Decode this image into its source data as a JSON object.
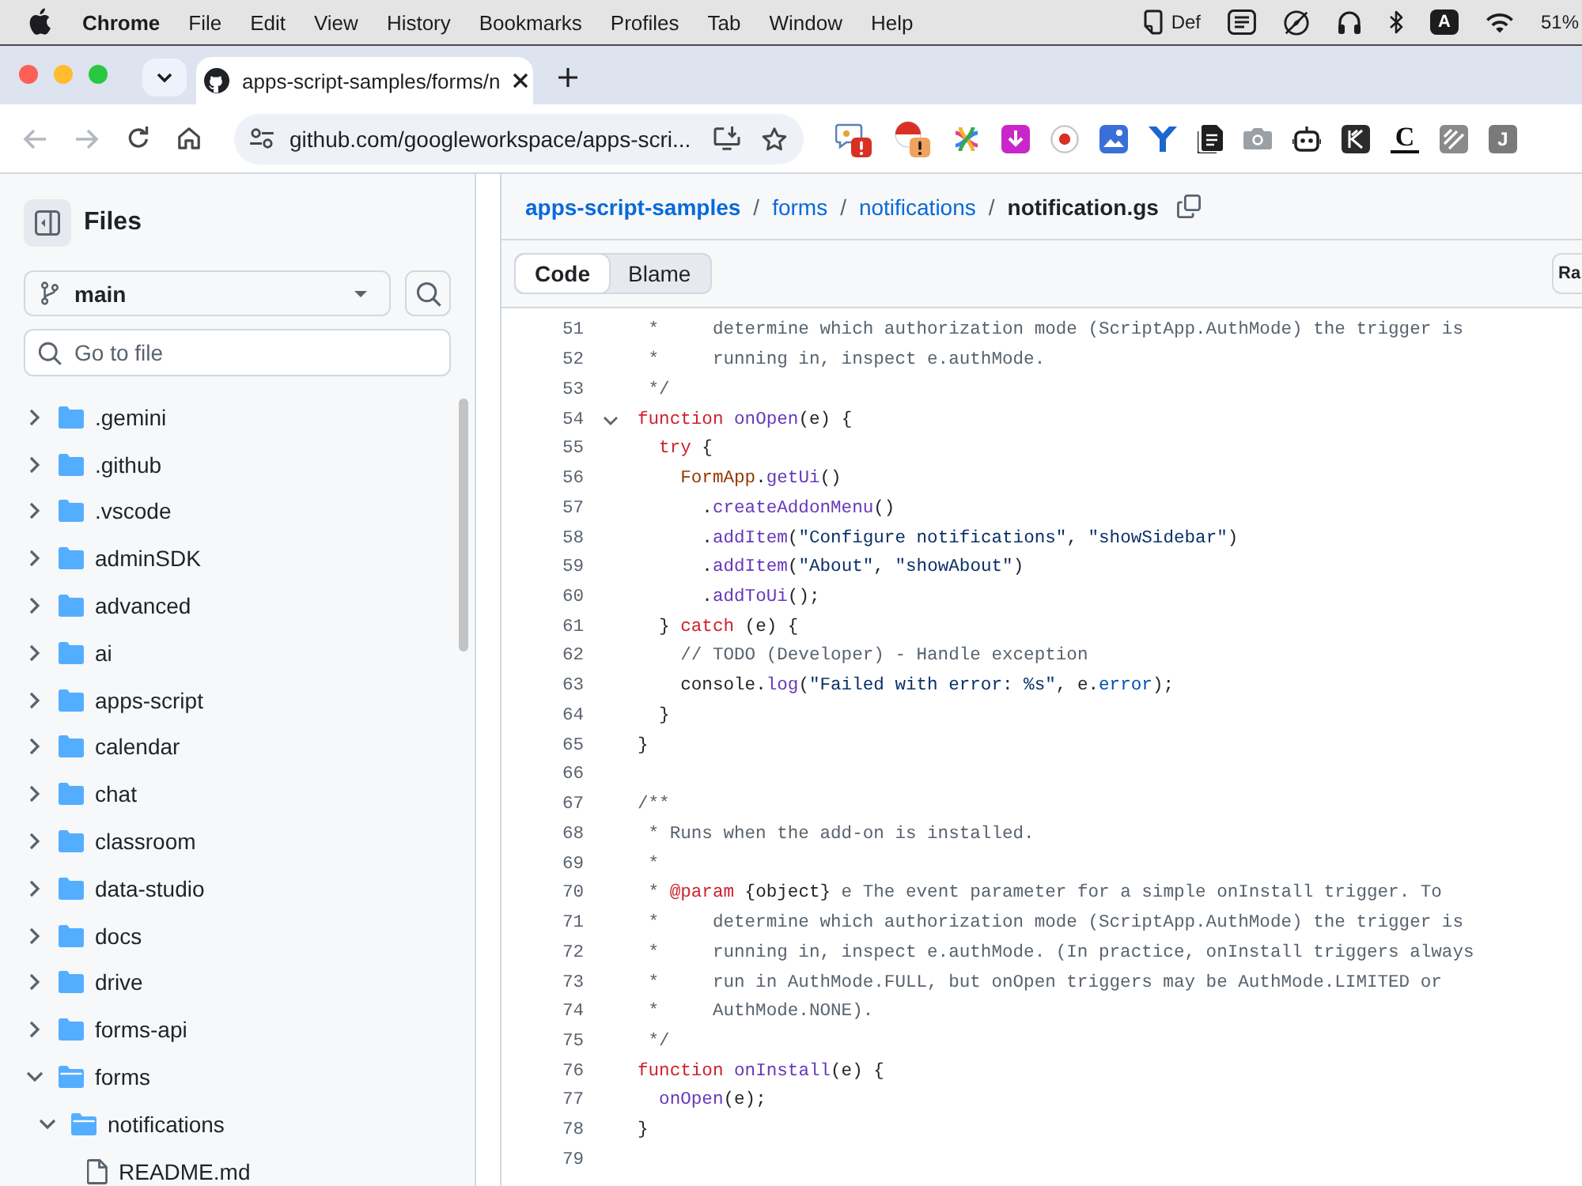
{
  "menu_bar": {
    "app_name": "Chrome",
    "menus": [
      "File",
      "Edit",
      "View",
      "History",
      "Bookmarks",
      "Profiles",
      "Tab",
      "Window",
      "Help"
    ],
    "status_label": "Def",
    "input_source": "A",
    "battery": "51%"
  },
  "browser": {
    "tabs": [
      {
        "title": "apps-script-samples/forms/n",
        "selected": true
      }
    ],
    "back": {
      "disabled": true
    },
    "forward": {
      "disabled": true
    },
    "url": "github.com/googleworkspace/apps-scri...",
    "extension_letters": [
      "C",
      "J"
    ]
  },
  "sidebar": {
    "title": "Files",
    "branch": "main",
    "file_search": {
      "placeholder": "Go to file"
    },
    "tree": [
      {
        "name": ".gemini",
        "kind": "folder",
        "expanded": false
      },
      {
        "name": ".github",
        "kind": "folder",
        "expanded": false
      },
      {
        "name": ".vscode",
        "kind": "folder",
        "expanded": false
      },
      {
        "name": "adminSDK",
        "kind": "folder",
        "expanded": false
      },
      {
        "name": "advanced",
        "kind": "folder",
        "expanded": false
      },
      {
        "name": "ai",
        "kind": "folder",
        "expanded": false
      },
      {
        "name": "apps-script",
        "kind": "folder",
        "expanded": false
      },
      {
        "name": "calendar",
        "kind": "folder",
        "expanded": false
      },
      {
        "name": "chat",
        "kind": "folder",
        "expanded": false
      },
      {
        "name": "classroom",
        "kind": "folder",
        "expanded": false
      },
      {
        "name": "data-studio",
        "kind": "folder",
        "expanded": false
      },
      {
        "name": "docs",
        "kind": "folder",
        "expanded": false
      },
      {
        "name": "drive",
        "kind": "folder",
        "expanded": false
      },
      {
        "name": "forms-api",
        "kind": "folder",
        "expanded": false
      },
      {
        "name": "forms",
        "kind": "folder",
        "expanded": true,
        "children": [
          {
            "name": "notifications",
            "kind": "folder",
            "expanded": true,
            "children": [
              {
                "name": "README.md",
                "kind": "file"
              }
            ]
          }
        ]
      }
    ]
  },
  "file_view": {
    "breadcrumb": [
      {
        "kind": "repo",
        "label": "apps-script-samples"
      },
      {
        "kind": "separator",
        "label": "/"
      },
      {
        "kind": "dir",
        "label": "forms"
      },
      {
        "kind": "separator",
        "label": "/"
      },
      {
        "kind": "dir",
        "label": "notifications"
      },
      {
        "kind": "separator",
        "label": "/"
      },
      {
        "kind": "file",
        "label": "notification.gs"
      }
    ],
    "view_tabs": [
      {
        "label": "Code",
        "selected": true
      },
      {
        "label": "Blame",
        "selected": false
      }
    ],
    "raw_button": "Ra",
    "lines": [
      {
        "number": "51",
        "fold": false,
        "tokens": [
          {
            "kind": "comment",
            "text": " *     determine which authorization mode (ScriptApp.AuthMode) the trigger is"
          }
        ]
      },
      {
        "number": "52",
        "fold": false,
        "tokens": [
          {
            "kind": "comment",
            "text": " *     running in, inspect e.authMode."
          }
        ]
      },
      {
        "number": "53",
        "fold": false,
        "tokens": [
          {
            "kind": "comment",
            "text": " */"
          }
        ]
      },
      {
        "number": "54",
        "fold": true,
        "tokens": [
          {
            "kind": "keyword",
            "text": "function"
          },
          {
            "kind": "function",
            "text": " onOpen"
          },
          {
            "kind": "plain",
            "text": "(e) {"
          }
        ]
      },
      {
        "number": "55",
        "fold": false,
        "tokens": [
          {
            "kind": "keyword",
            "text": "  try"
          },
          {
            "kind": "plain",
            "text": " {"
          }
        ]
      },
      {
        "number": "56",
        "fold": false,
        "tokens": [
          {
            "kind": "class",
            "text": "    FormApp"
          },
          {
            "kind": "plain",
            "text": "."
          },
          {
            "kind": "function",
            "text": "getUi"
          },
          {
            "kind": "plain",
            "text": "()"
          }
        ]
      },
      {
        "number": "57",
        "fold": false,
        "tokens": [
          {
            "kind": "plain",
            "text": "      ."
          },
          {
            "kind": "function",
            "text": "createAddonMenu"
          },
          {
            "kind": "plain",
            "text": "()"
          }
        ]
      },
      {
        "number": "58",
        "fold": false,
        "tokens": [
          {
            "kind": "plain",
            "text": "      ."
          },
          {
            "kind": "function",
            "text": "addItem"
          },
          {
            "kind": "plain",
            "text": "("
          },
          {
            "kind": "string",
            "text": "\"Configure notifications\""
          },
          {
            "kind": "plain",
            "text": ", "
          },
          {
            "kind": "string",
            "text": "\"showSidebar\""
          },
          {
            "kind": "plain",
            "text": ")"
          }
        ]
      },
      {
        "number": "59",
        "fold": false,
        "tokens": [
          {
            "kind": "plain",
            "text": "      ."
          },
          {
            "kind": "function",
            "text": "addItem"
          },
          {
            "kind": "plain",
            "text": "("
          },
          {
            "kind": "string",
            "text": "\"About\""
          },
          {
            "kind": "plain",
            "text": ", "
          },
          {
            "kind": "string",
            "text": "\"showAbout\""
          },
          {
            "kind": "plain",
            "text": ")"
          }
        ]
      },
      {
        "number": "60",
        "fold": false,
        "tokens": [
          {
            "kind": "plain",
            "text": "      ."
          },
          {
            "kind": "function",
            "text": "addToUi"
          },
          {
            "kind": "plain",
            "text": "();"
          }
        ]
      },
      {
        "number": "61",
        "fold": false,
        "tokens": [
          {
            "kind": "plain",
            "text": "  } "
          },
          {
            "kind": "keyword",
            "text": "catch"
          },
          {
            "kind": "plain",
            "text": " (e) {"
          }
        ]
      },
      {
        "number": "62",
        "fold": false,
        "tokens": [
          {
            "kind": "comment",
            "text": "    // TODO (Developer) - Handle exception"
          }
        ]
      },
      {
        "number": "63",
        "fold": false,
        "tokens": [
          {
            "kind": "plain",
            "text": "    console."
          },
          {
            "kind": "function",
            "text": "log"
          },
          {
            "kind": "plain",
            "text": "("
          },
          {
            "kind": "string",
            "text": "\"Failed with error: %s\""
          },
          {
            "kind": "plain",
            "text": ", e."
          },
          {
            "kind": "property",
            "text": "error"
          },
          {
            "kind": "plain",
            "text": ");"
          }
        ]
      },
      {
        "number": "64",
        "fold": false,
        "tokens": [
          {
            "kind": "plain",
            "text": "  }"
          }
        ]
      },
      {
        "number": "65",
        "fold": false,
        "tokens": [
          {
            "kind": "plain",
            "text": "}"
          }
        ]
      },
      {
        "number": "66",
        "fold": false
      },
      {
        "number": "67",
        "fold": false,
        "tokens": [
          {
            "kind": "comment",
            "text": "/**"
          }
        ]
      },
      {
        "number": "68",
        "fold": false,
        "tokens": [
          {
            "kind": "comment",
            "text": " * Runs when the add-on is installed."
          }
        ]
      },
      {
        "number": "69",
        "fold": false,
        "tokens": [
          {
            "kind": "comment",
            "text": " *"
          }
        ]
      },
      {
        "number": "70",
        "fold": false,
        "tokens": [
          {
            "kind": "comment",
            "text": " * "
          },
          {
            "kind": "tag",
            "text": "@param"
          },
          {
            "kind": "plain",
            "text": " {object}"
          },
          {
            "kind": "comment",
            "text": " e The event parameter for a simple onInstall trigger. To"
          }
        ]
      },
      {
        "number": "71",
        "fold": false,
        "tokens": [
          {
            "kind": "comment",
            "text": " *     determine which authorization mode (ScriptApp.AuthMode) the trigger is"
          }
        ]
      },
      {
        "number": "72",
        "fold": false,
        "tokens": [
          {
            "kind": "comment",
            "text": " *     running in, inspect e.authMode. (In practice, onInstall triggers always"
          }
        ]
      },
      {
        "number": "73",
        "fold": false,
        "tokens": [
          {
            "kind": "comment",
            "text": " *     run in AuthMode.FULL, but onOpen triggers may be AuthMode.LIMITED or"
          }
        ]
      },
      {
        "number": "74",
        "fold": false,
        "tokens": [
          {
            "kind": "comment",
            "text": " *     AuthMode.NONE)."
          }
        ]
      },
      {
        "number": "75",
        "fold": false,
        "tokens": [
          {
            "kind": "comment",
            "text": " */"
          }
        ]
      },
      {
        "number": "76",
        "fold": false,
        "tokens": [
          {
            "kind": "keyword",
            "text": "function"
          },
          {
            "kind": "function",
            "text": " onInstall"
          },
          {
            "kind": "plain",
            "text": "(e) {"
          }
        ]
      },
      {
        "number": "77",
        "fold": false,
        "tokens": [
          {
            "kind": "function",
            "text": "  onOpen"
          },
          {
            "kind": "plain",
            "text": "(e);"
          }
        ]
      },
      {
        "number": "78",
        "fold": false,
        "tokens": [
          {
            "kind": "plain",
            "text": "}"
          }
        ]
      },
      {
        "number": "79",
        "fold": false
      }
    ]
  }
}
